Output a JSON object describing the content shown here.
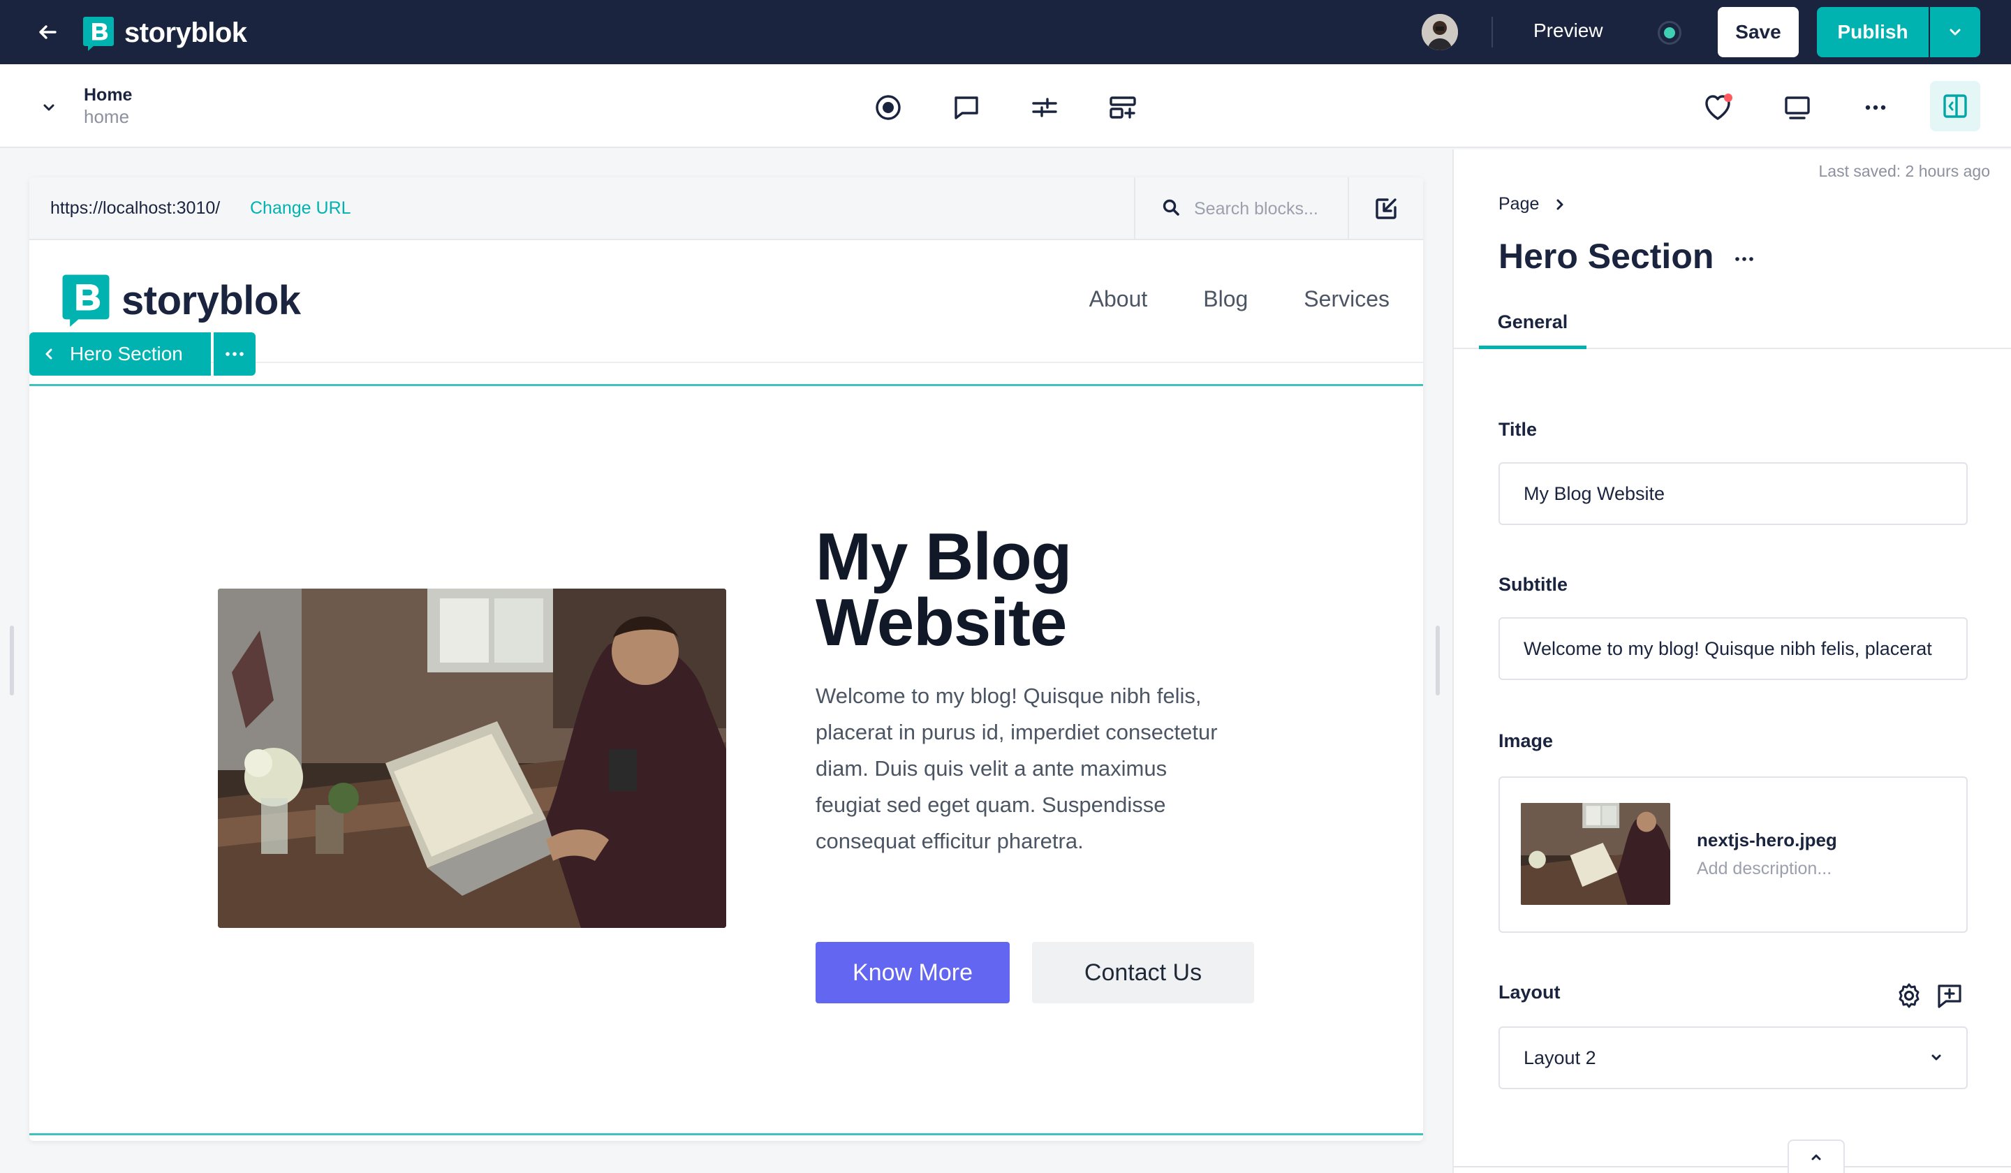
{
  "topbar": {
    "brand": "storyblok",
    "preview_label": "Preview",
    "save_label": "Save",
    "publish_label": "Publish"
  },
  "story": {
    "name": "Home",
    "slug": "home"
  },
  "preview": {
    "url": "https://localhost:3010/",
    "change_url_label": "Change URL",
    "search_placeholder": "Search blocks..."
  },
  "site": {
    "brand": "storyblok",
    "nav": [
      "About",
      "Blog",
      "Services"
    ],
    "block_tag": "Hero Section",
    "hero": {
      "title": "My Blog Website",
      "subtitle": "Welcome to my blog! Quisque nibh felis, placerat in purus id, imperdiet consectetur diam. Duis quis velit a ante maximus feugiat sed eget quam. Suspendisse consequat efficitur pharetra.",
      "primary_button": "Know More",
      "secondary_button": "Contact Us"
    }
  },
  "panel": {
    "last_saved": "Last saved: 2 hours ago",
    "breadcrumb": "Page",
    "title": "Hero Section",
    "tab_general": "General",
    "title_label": "Title",
    "title_value": "My Blog Website",
    "subtitle_label": "Subtitle",
    "subtitle_value": "Welcome to my blog! Quisque nibh felis, placerat",
    "image_label": "Image",
    "image_filename": "nextjs-hero.jpeg",
    "image_description_placeholder": "Add description...",
    "layout_label": "Layout",
    "layout_value": "Layout 2"
  },
  "colors": {
    "topbar_bg": "#1b243f",
    "accent": "#00b3b0",
    "hero_primary": "#6366f1"
  }
}
